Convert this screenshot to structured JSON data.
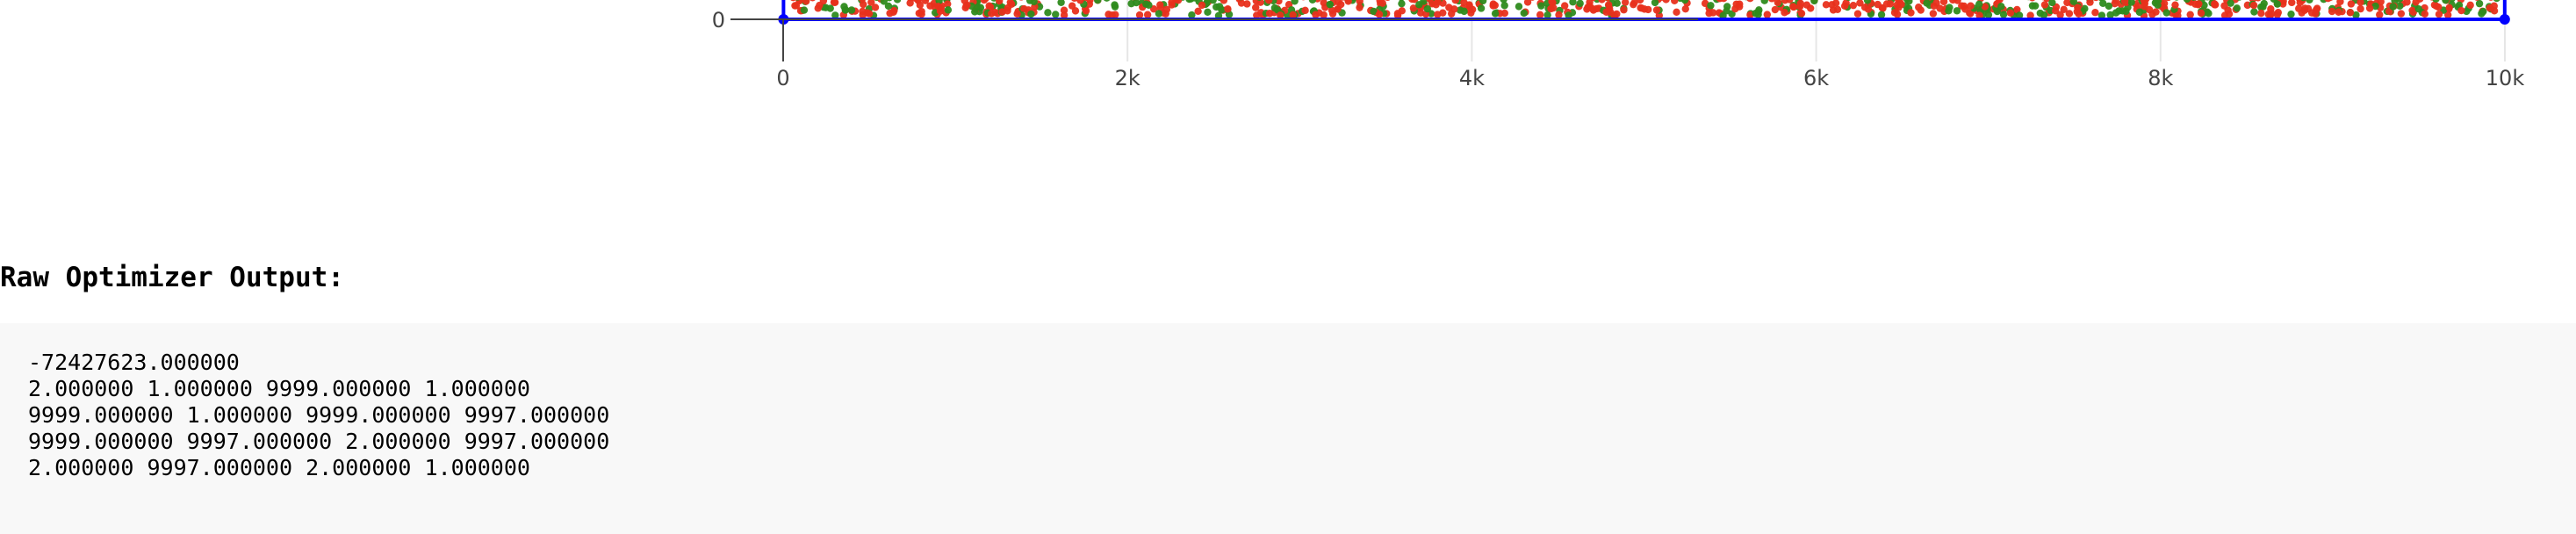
{
  "chart_data": {
    "type": "scatter",
    "x_ticks": [
      "0",
      "2k",
      "4k",
      "6k",
      "8k",
      "10k"
    ],
    "x_tick_values": [
      0,
      2000,
      4000,
      6000,
      8000,
      10000
    ],
    "y_ticks": [
      "0"
    ],
    "y_tick_values": [
      0
    ],
    "xlim": [
      0,
      10600
    ],
    "series": [
      {
        "color": "#e8301c",
        "marker": "dot"
      },
      {
        "color": "#2e8b1e",
        "marker": "dot"
      },
      {
        "color": "#0000ff",
        "marker": "line",
        "x": [
          2,
          9999
        ],
        "y": [
          1,
          1
        ]
      }
    ],
    "grid": true
  },
  "raw_output": {
    "heading": "Raw Optimizer Output:",
    "lines": [
      "-72427623.000000",
      "2.000000 1.000000 9999.000000 1.000000",
      "9999.000000 1.000000 9999.000000 9997.000000",
      "9999.000000 9997.000000 2.000000 9997.000000",
      "2.000000 9997.000000 2.000000 1.000000"
    ]
  }
}
